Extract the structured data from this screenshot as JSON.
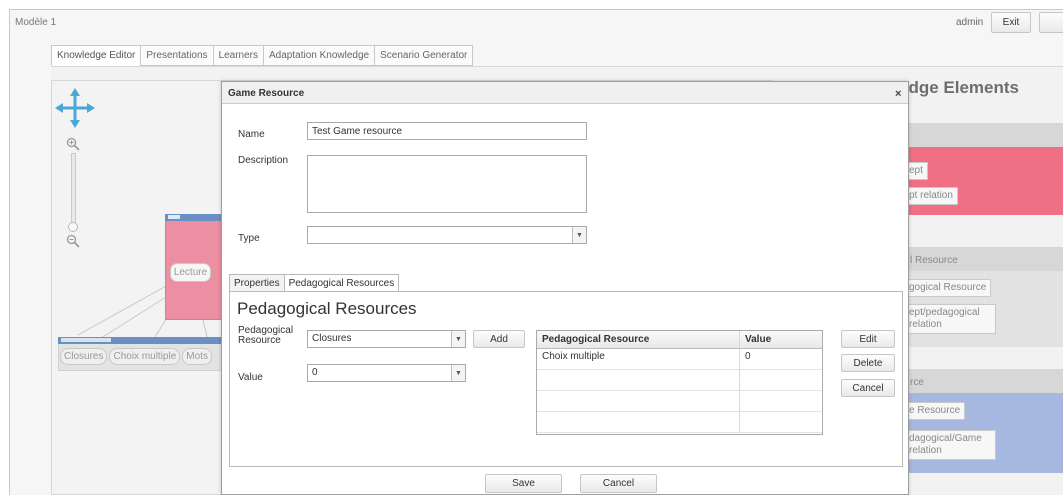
{
  "app": {
    "title": "Modèle 1",
    "user": "admin",
    "exit_label": "Exit"
  },
  "main_tabs": [
    {
      "label": "Knowledge Editor",
      "active": true
    },
    {
      "label": "Presentations"
    },
    {
      "label": "Learners"
    },
    {
      "label": "Adaptation Knowledge"
    },
    {
      "label": "Scenario Generator"
    }
  ],
  "canvas": {
    "concept_node": "Lecture",
    "resource_nodes": [
      "Closures",
      "Choix multiple",
      "Mots"
    ]
  },
  "knowledge_elements": {
    "title": "Knowledge Elements",
    "sections": [
      {
        "header": "",
        "color": "#ef6f84",
        "items": [
          "ept",
          "pt relation"
        ]
      },
      {
        "header": "l Resource",
        "color": "#e2e2e2",
        "items": [
          "gogical Resource",
          "ept/pedagogical relation"
        ]
      },
      {
        "header": "rce",
        "color": "#a6b8df",
        "items": [
          "e Resource",
          "dagogical/Game relation"
        ]
      }
    ]
  },
  "dialog": {
    "title": "Game Resource",
    "name_label": "Name",
    "name_value": "Test Game resource",
    "description_label": "Description",
    "description_value": "",
    "type_label": "Type",
    "type_value": "",
    "tabs": [
      {
        "label": "Properties"
      },
      {
        "label": "Pedagogical Resources",
        "active": true
      }
    ],
    "section_title": "Pedagogical Resources",
    "ped_resource_label": "Pedagogical Resource",
    "ped_resource_value": "Closures",
    "add_label": "Add",
    "value_label": "Value",
    "value_value": "0",
    "table": {
      "columns": [
        "Pedagogical Resource",
        "Value"
      ],
      "rows": [
        [
          "Choix multiple",
          "0"
        ],
        [
          "",
          ""
        ],
        [
          "",
          ""
        ],
        [
          "",
          ""
        ]
      ]
    },
    "edit_label": "Edit",
    "delete_label": "Delete",
    "cancel_label": "Cancel",
    "save_label": "Save",
    "footer_cancel_label": "Cancel"
  }
}
